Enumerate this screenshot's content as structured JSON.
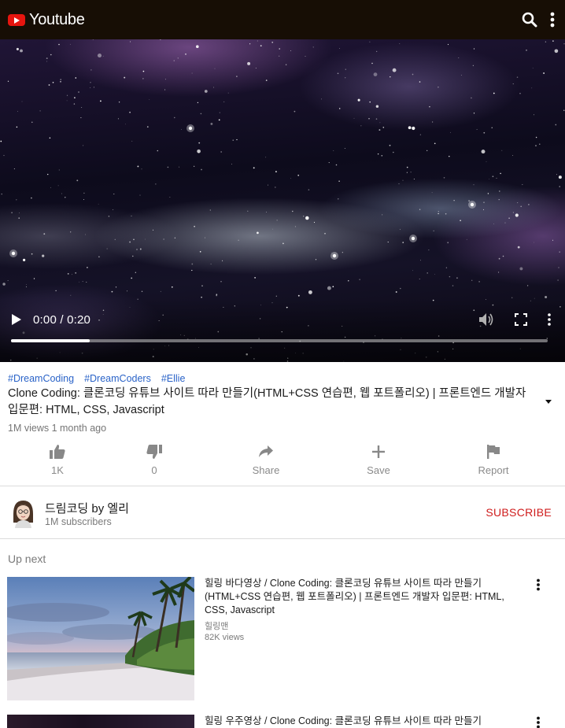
{
  "header": {
    "brand": "Youtube",
    "icons": [
      "youtube-logo-icon",
      "search-icon",
      "more-vert-icon"
    ],
    "colors": {
      "bar": "#170e05",
      "logo": "#e6150f"
    }
  },
  "player": {
    "time": "0:00 / 0:20",
    "progress": 0.146,
    "icons": [
      "play-icon",
      "volume-icon",
      "fullscreen-icon",
      "more-vert-icon"
    ]
  },
  "video": {
    "tags": [
      "#DreamCoding",
      "#DreamCoders",
      "#Ellie"
    ],
    "title": "Clone Coding: 클론코딩 유튜브 사이트 따라 만들기(HTML+CSS 연습편, 웹 포트폴리오) | 프론트엔드 개발자 입문편: HTML, CSS, Javascript",
    "meta": "1M views 1 month ago",
    "actions": [
      {
        "label": "1K",
        "icon": "thumbs-up-icon"
      },
      {
        "label": "0",
        "icon": "thumbs-down-icon"
      },
      {
        "label": "Share",
        "icon": "share-icon"
      },
      {
        "label": "Save",
        "icon": "plus-icon"
      },
      {
        "label": "Report",
        "icon": "flag-icon"
      }
    ]
  },
  "channel": {
    "name": "드림코딩 by 엘리",
    "subscribers": "1M subscribers",
    "subscribe_label": "SUBSCRIBE",
    "subscribe_color": "#cf1b1b"
  },
  "upnext": {
    "heading": "Up next",
    "items": [
      {
        "title": "힐링 바다영상 / Clone Coding: 클론코딩 유튜브 사이트 따라 만들기(HTML+CSS 연습편, 웹 포트폴리오) | 프론트엔드 개발자 입문편: HTML, CSS, Javascript",
        "channel": "힐링맨",
        "views": "82K views"
      },
      {
        "title": "힐링 우주영상 / Clone Coding: 클론코딩 유튜브 사이트 따라 만들기",
        "channel": "",
        "views": ""
      }
    ]
  }
}
